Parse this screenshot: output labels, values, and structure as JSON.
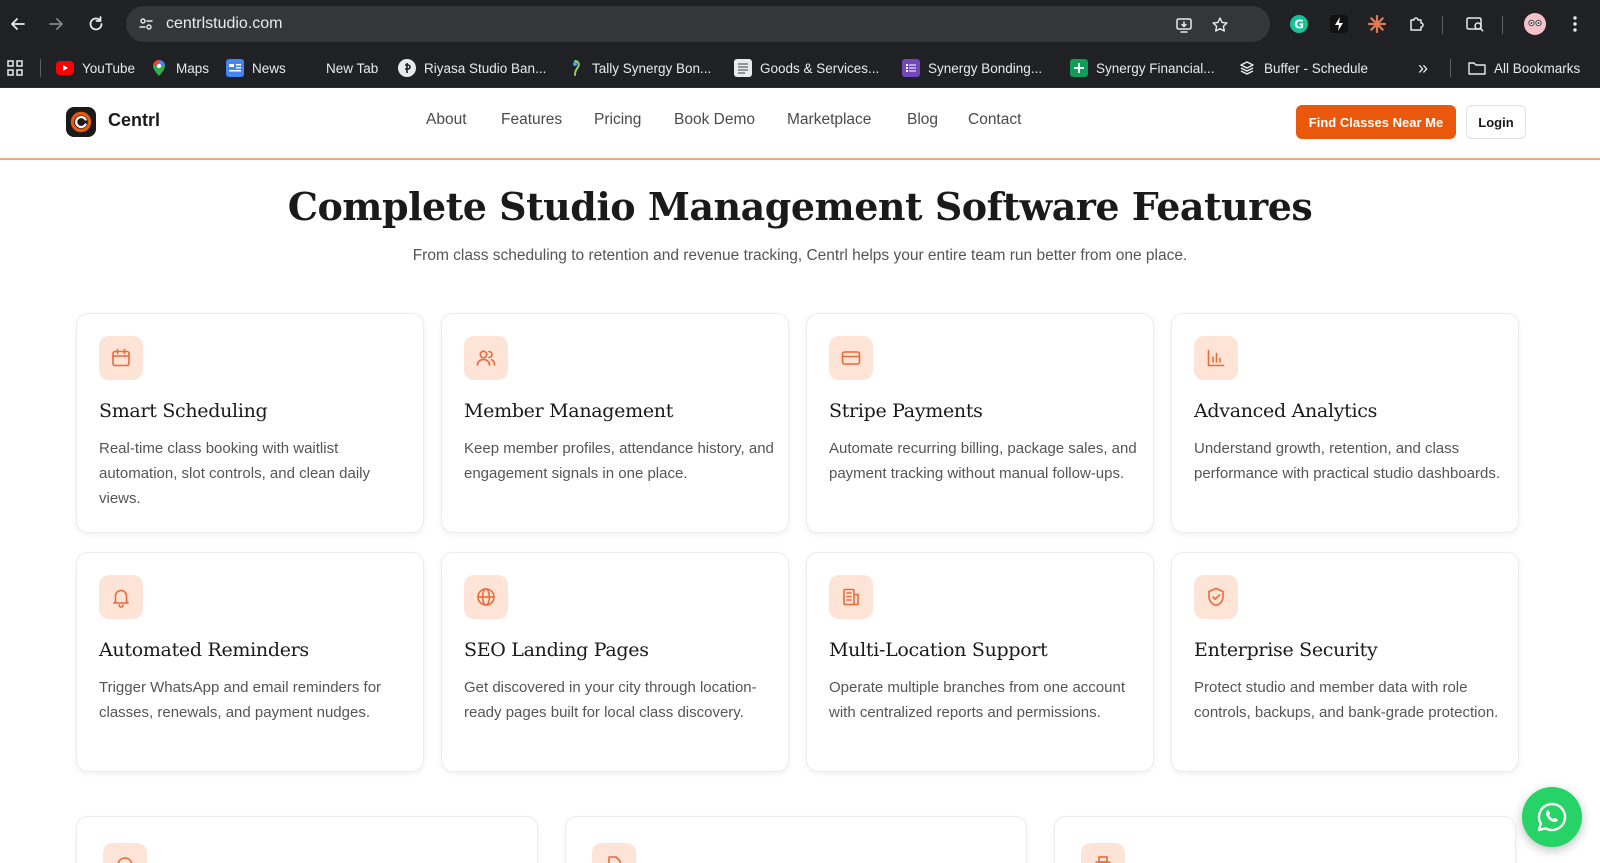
{
  "browser": {
    "url": "centrlstudio.com",
    "bookmarks": [
      {
        "label": "YouTube",
        "icon": "youtube-icon"
      },
      {
        "label": "Maps",
        "icon": "maps-pin-icon"
      },
      {
        "label": "News",
        "icon": "news-icon"
      },
      {
        "label": "New Tab",
        "icon": "blank-icon"
      },
      {
        "label": "Riyasa Studio Ban...",
        "icon": "riyasa-icon"
      },
      {
        "label": "Tally Synergy Bon...",
        "icon": "tally-icon"
      },
      {
        "label": "Goods & Services...",
        "icon": "document-icon"
      },
      {
        "label": "Synergy Bonding...",
        "icon": "forms-icon"
      },
      {
        "label": "Synergy Financial...",
        "icon": "sheets-icon"
      },
      {
        "label": "Buffer - Schedule",
        "icon": "buffer-icon"
      }
    ],
    "more_label": "»",
    "all_bookmarks_label": "All Bookmarks"
  },
  "site": {
    "brand": "Centrl",
    "nav": [
      "About",
      "Features",
      "Pricing",
      "Book Demo",
      "Marketplace",
      "Blog",
      "Contact"
    ],
    "cta_label": "Find Classes Near Me",
    "login_label": "Login"
  },
  "hero": {
    "title": "Complete Studio Management Software Features",
    "subtitle": "From class scheduling to retention and revenue tracking, Centrl helps your entire team run better from one place."
  },
  "features": [
    {
      "title": "Smart Scheduling",
      "desc": "Real-time class booking with waitlist automation, slot controls, and clean daily views.",
      "icon": "calendar-icon"
    },
    {
      "title": "Member Management",
      "desc": "Keep member profiles, attendance history, and engagement signals in one place.",
      "icon": "users-icon"
    },
    {
      "title": "Stripe Payments",
      "desc": "Automate recurring billing, package sales, and payment tracking without manual follow-ups.",
      "icon": "credit-card-icon"
    },
    {
      "title": "Advanced Analytics",
      "desc": "Understand growth, retention, and class performance with practical studio dashboards.",
      "icon": "bar-chart-icon"
    },
    {
      "title": "Automated Reminders",
      "desc": "Trigger WhatsApp and email reminders for classes, renewals, and payment nudges.",
      "icon": "bell-icon"
    },
    {
      "title": "SEO Landing Pages",
      "desc": "Get discovered in your city through location-ready pages built for local class discovery.",
      "icon": "globe-icon"
    },
    {
      "title": "Multi-Location Support",
      "desc": "Operate multiple branches from one account with centralized reports and permissions.",
      "icon": "building-icon"
    },
    {
      "title": "Enterprise Security",
      "desc": "Protect studio and member data with role controls, backups, and bank-grade protection.",
      "icon": "shield-check-icon"
    }
  ],
  "colors": {
    "accent": "#ea580c",
    "icon_bg": "#fde4d6",
    "icon_stroke": "#ea6a3a",
    "whatsapp": "#25d366"
  }
}
